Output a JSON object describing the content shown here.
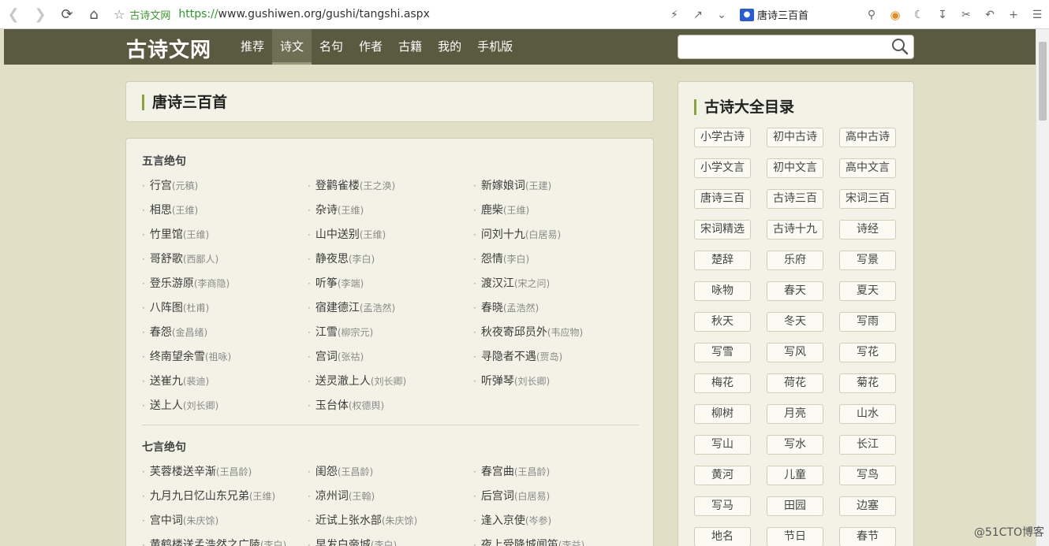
{
  "browser": {
    "site_name": "古诗文网",
    "url_proto": "https://",
    "url_rest": "www.gushiwen.org/gushi/tangshi.aspx",
    "tab_title": "唐诗三百首"
  },
  "header": {
    "logo": "古诗文网",
    "nav": [
      "推荐",
      "诗文",
      "名句",
      "作者",
      "古籍",
      "我的",
      "手机版"
    ],
    "search_placeholder": ""
  },
  "main": {
    "title": "唐诗三百首",
    "sections": [
      {
        "heading": "五言绝句",
        "poems": [
          {
            "t": "行宫",
            "a": "(元稹)"
          },
          {
            "t": "登鹳雀楼",
            "a": "(王之涣)"
          },
          {
            "t": "新嫁娘词",
            "a": "(王建)"
          },
          {
            "t": "相思",
            "a": "(王维)"
          },
          {
            "t": "杂诗",
            "a": "(王维)"
          },
          {
            "t": "鹿柴",
            "a": "(王维)"
          },
          {
            "t": "竹里馆",
            "a": "(王维)"
          },
          {
            "t": "山中送别",
            "a": "(王维)"
          },
          {
            "t": "问刘十九",
            "a": "(白居易)"
          },
          {
            "t": "哥舒歌",
            "a": "(西鄙人)"
          },
          {
            "t": "静夜思",
            "a": "(李白)"
          },
          {
            "t": "怨情",
            "a": "(李白)"
          },
          {
            "t": "登乐游原",
            "a": "(李商隐)"
          },
          {
            "t": "听筝",
            "a": "(李端)"
          },
          {
            "t": "渡汉江",
            "a": "(宋之问)"
          },
          {
            "t": "八阵图",
            "a": "(杜甫)"
          },
          {
            "t": "宿建德江",
            "a": "(孟浩然)"
          },
          {
            "t": "春晓",
            "a": "(孟浩然)"
          },
          {
            "t": "春怨",
            "a": "(金昌绪)"
          },
          {
            "t": "江雪",
            "a": "(柳宗元)"
          },
          {
            "t": "秋夜寄邱员外",
            "a": "(韦应物)"
          },
          {
            "t": "终南望余雪",
            "a": "(祖咏)"
          },
          {
            "t": "宫词",
            "a": "(张祜)"
          },
          {
            "t": "寻隐者不遇",
            "a": "(贾岛)"
          },
          {
            "t": "送崔九",
            "a": "(裴迪)"
          },
          {
            "t": "送灵澈上人",
            "a": "(刘长卿)"
          },
          {
            "t": "听弹琴",
            "a": "(刘长卿)"
          },
          {
            "t": "送上人",
            "a": "(刘长卿)"
          },
          {
            "t": "玉台体",
            "a": "(权德舆)"
          }
        ]
      },
      {
        "heading": "七言绝句",
        "poems": [
          {
            "t": "芙蓉楼送辛渐",
            "a": "(王昌龄)"
          },
          {
            "t": "闺怨",
            "a": "(王昌龄)"
          },
          {
            "t": "春宫曲",
            "a": "(王昌龄)"
          },
          {
            "t": "九月九日忆山东兄弟",
            "a": "(王维)"
          },
          {
            "t": "凉州词",
            "a": "(王翰)"
          },
          {
            "t": "后宫词",
            "a": "(白居易)"
          },
          {
            "t": "宫中词",
            "a": "(朱庆馀)"
          },
          {
            "t": "近试上张水部",
            "a": "(朱庆馀)"
          },
          {
            "t": "逢入京使",
            "a": "(岑参)"
          },
          {
            "t": "黄鹤楼送孟浩然之广陵",
            "a": "(李白)"
          },
          {
            "t": "早发白帝城",
            "a": "(李白)"
          },
          {
            "t": "夜上受降城闻笛",
            "a": "(李益)"
          }
        ]
      }
    ]
  },
  "sidebar": {
    "title": "古诗大全目录",
    "tags": [
      "小学古诗",
      "初中古诗",
      "高中古诗",
      "小学文言",
      "初中文言",
      "高中文言",
      "唐诗三百",
      "古诗三百",
      "宋词三百",
      "宋词精选",
      "古诗十九",
      "诗经",
      "楚辞",
      "乐府",
      "写景",
      "咏物",
      "春天",
      "夏天",
      "秋天",
      "冬天",
      "写雨",
      "写雪",
      "写风",
      "写花",
      "梅花",
      "荷花",
      "菊花",
      "柳树",
      "月亮",
      "山水",
      "写山",
      "写水",
      "长江",
      "黄河",
      "儿童",
      "写鸟",
      "写马",
      "田园",
      "边塞",
      "地名",
      "节日",
      "春节"
    ]
  },
  "watermark": "@51CTO博客"
}
